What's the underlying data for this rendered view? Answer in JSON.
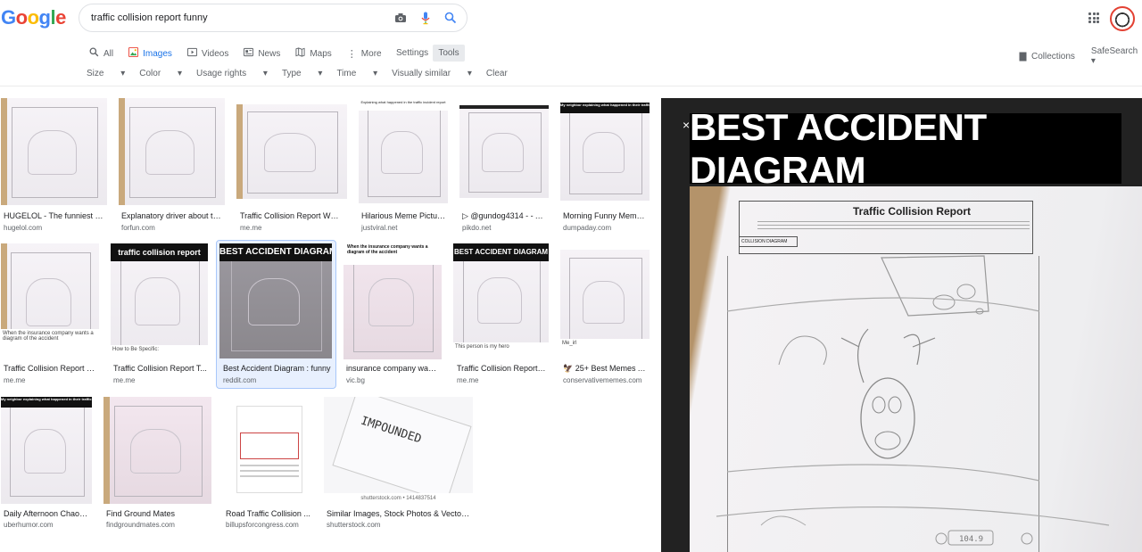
{
  "header": {
    "logo": "Google",
    "query": "traffic collision report funny"
  },
  "tabs": [
    {
      "label": "All",
      "icon": "search-icon",
      "active": false
    },
    {
      "label": "Images",
      "icon": "image-icon",
      "active": true
    },
    {
      "label": "Videos",
      "icon": "video-icon",
      "active": false
    },
    {
      "label": "News",
      "icon": "news-icon",
      "active": false
    },
    {
      "label": "Maps",
      "icon": "map-icon",
      "active": false
    },
    {
      "label": "More",
      "icon": "more-icon",
      "active": false
    }
  ],
  "settings_label": "Settings",
  "tools_label": "Tools",
  "right_links": {
    "collections": "Collections",
    "safesearch": "SafeSearch"
  },
  "filters": [
    "Size",
    "Color",
    "Usage rights",
    "Type",
    "Time",
    "Visually similar",
    "Clear"
  ],
  "results": [
    {
      "title": "HUGELOL - The funniest pl...",
      "site": "hugelol.com"
    },
    {
      "title": "Explanatory driver about th...",
      "site": "forfun.com"
    },
    {
      "title": "Traffic Collision Report Whe...",
      "site": "me.me"
    },
    {
      "title": "Hilarious Meme Pictur...",
      "site": "justviral.net"
    },
    {
      "title": "▷ @gundog4314 - - A...",
      "site": "pikdo.net"
    },
    {
      "title": "Morning Funny Meme ...",
      "site": "dumpaday.com"
    },
    {
      "title": "Traffic Collision Report W...",
      "site": "me.me",
      "note": "When the insurance company wants a diagram of the accident"
    },
    {
      "title": "Traffic Collision Report T...",
      "site": "me.me",
      "banner": "traffic collision report",
      "note": "How to Be Specific:"
    },
    {
      "title": "Best Accident Diagram : funny",
      "site": "reddit.com",
      "banner": "BEST ACCIDENT DIAGRAM"
    },
    {
      "title": "insurance company want...",
      "site": "vic.bg",
      "banner": "When the insurance company wants a diagram of the accident"
    },
    {
      "title": "Traffic Collision Report ...",
      "site": "me.me",
      "banner": "BEST ACCIDENT DIAGRAM",
      "note": "This person is my hero"
    },
    {
      "title": "25+ Best Memes A...",
      "site": "conservativememes.com",
      "note": "Me_irl"
    },
    {
      "title": "Daily Afternoon Chaos ...",
      "site": "uberhumor.com"
    },
    {
      "title": "Find Ground Mates",
      "site": "findgroundmates.com"
    },
    {
      "title": "Road Traffic Collision ...",
      "site": "billupsforcongress.com"
    },
    {
      "title": "Similar Images, Stock Photos & Vectors ...",
      "site": "shutterstock.com"
    }
  ],
  "preview": {
    "banner": "BEST ACCIDENT DIAGRAM",
    "form_title": "Traffic Collision Report",
    "diagram_label": "COLLISION DIAGRAM",
    "close": "×"
  }
}
